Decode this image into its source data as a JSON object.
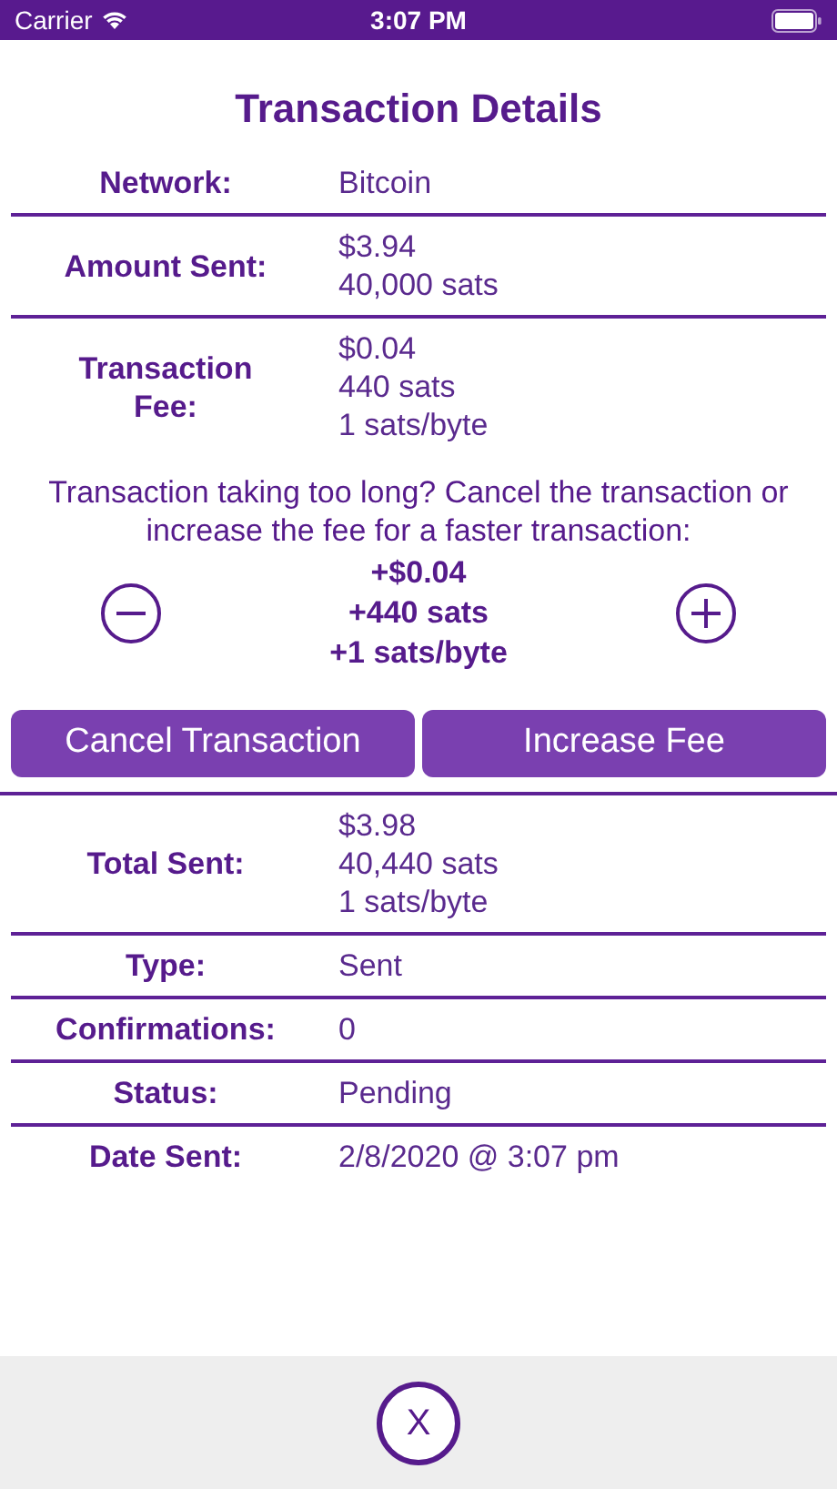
{
  "status_bar": {
    "carrier": "Carrier",
    "time": "3:07 PM"
  },
  "title": "Transaction Details",
  "details": [
    {
      "label": "Network:",
      "values": [
        "Bitcoin"
      ]
    },
    {
      "label": "Amount Sent:",
      "values": [
        "$3.94",
        "40,000 sats"
      ]
    },
    {
      "label": "Transaction Fee:",
      "values": [
        "$0.04",
        "440 sats",
        "1 sats/byte"
      ]
    }
  ],
  "fee_prompt": "Transaction taking too long? Cancel the transaction or increase the fee for a faster transaction:",
  "fee_adjust": {
    "lines": [
      "+$0.04",
      "+440 sats",
      "+1 sats/byte"
    ]
  },
  "buttons": [
    "Cancel Transaction",
    "Increase Fee"
  ],
  "summary": [
    {
      "label": "Total Sent:",
      "values": [
        "$3.98",
        "40,440 sats",
        "1 sats/byte"
      ]
    },
    {
      "label": "Type:",
      "values": [
        "Sent"
      ]
    },
    {
      "label": "Confirmations:",
      "values": [
        "0"
      ]
    },
    {
      "label": "Status:",
      "values": [
        "Pending"
      ]
    },
    {
      "label": "Date Sent:",
      "values": [
        "2/8/2020 @ 3:07 pm"
      ]
    }
  ],
  "close_button": "X"
}
